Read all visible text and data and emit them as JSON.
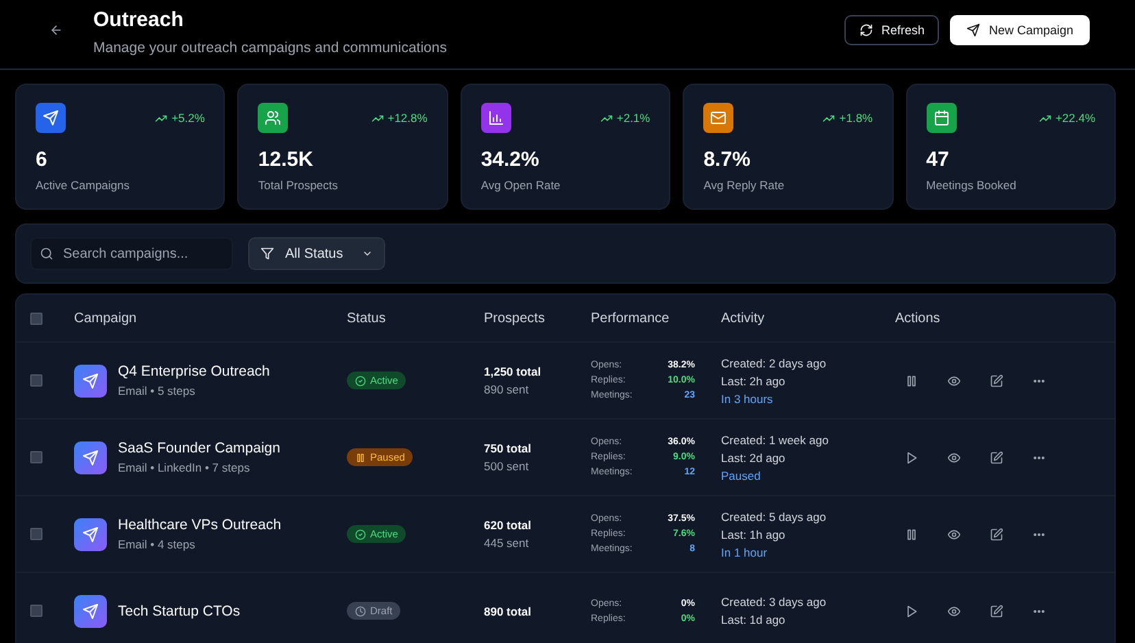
{
  "header": {
    "title": "Outreach",
    "subtitle": "Manage your outreach campaigns and communications"
  },
  "buttons": [
    {
      "kind": "refresh",
      "label": "Refresh"
    },
    {
      "kind": "new",
      "label": "New Campaign"
    }
  ],
  "stats": [
    {
      "color": "#2563eb",
      "change": "+5.2%",
      "value": "6",
      "label": "Active Campaigns"
    },
    {
      "color": "#16a34a",
      "change": "+12.8%",
      "value": "12.5K",
      "label": "Total Prospects"
    },
    {
      "color": "#9333ea",
      "change": "+2.1%",
      "value": "34.2%",
      "label": "Avg Open Rate"
    },
    {
      "color": "#d97706",
      "change": "+1.8%",
      "value": "8.7%",
      "label": "Avg Reply Rate"
    },
    {
      "color": "#16a34a",
      "change": "+22.4%",
      "value": "47",
      "label": "Meetings Booked"
    }
  ],
  "filters": {
    "search": {
      "placeholder": "Search campaigns..."
    },
    "status_filter": {
      "value": "All Status"
    }
  },
  "table": {
    "select_all": {
      "checked": false
    },
    "columns": [
      "Campaign",
      "Status",
      "Prospects",
      "Performance",
      "Activity",
      "Actions"
    ],
    "rows": [
      {
        "checked": false,
        "name": "Q4 Enterprise Outreach",
        "channels": "Email • 5 steps",
        "status": {
          "kind": "active",
          "label": "Active"
        },
        "total": "1,250 total",
        "sent": "890 sent",
        "performance": [
          {
            "kind": "opens",
            "label": "Opens:",
            "value": "38.2%"
          },
          {
            "kind": "replies",
            "label": "Replies:",
            "value": "10.0%"
          },
          {
            "kind": "meetings",
            "label": "Meetings:",
            "value": "23"
          }
        ],
        "created": "Created: 2 days ago",
        "last": "Last: 2h ago",
        "next": "In 3 hours"
      },
      {
        "checked": false,
        "name": "SaaS Founder Campaign",
        "channels": "Email • LinkedIn • 7 steps",
        "status": {
          "kind": "paused",
          "label": "Paused"
        },
        "total": "750 total",
        "sent": "500 sent",
        "performance": [
          {
            "kind": "opens",
            "label": "Opens:",
            "value": "36.0%"
          },
          {
            "kind": "replies",
            "label": "Replies:",
            "value": "9.0%"
          },
          {
            "kind": "meetings",
            "label": "Meetings:",
            "value": "12"
          }
        ],
        "created": "Created: 1 week ago",
        "last": "Last: 2d ago",
        "next": "Paused"
      },
      {
        "checked": false,
        "name": "Healthcare VPs Outreach",
        "channels": "Email • 4 steps",
        "status": {
          "kind": "active",
          "label": "Active"
        },
        "total": "620 total",
        "sent": "445 sent",
        "performance": [
          {
            "kind": "opens",
            "label": "Opens:",
            "value": "37.5%"
          },
          {
            "kind": "replies",
            "label": "Replies:",
            "value": "7.6%"
          },
          {
            "kind": "meetings",
            "label": "Meetings:",
            "value": "8"
          }
        ],
        "created": "Created: 5 days ago",
        "last": "Last: 1h ago",
        "next": "In 1 hour"
      },
      {
        "checked": false,
        "name": "Tech Startup CTOs",
        "status": {
          "kind": "draft",
          "label": "Draft"
        },
        "total": "890 total",
        "performance": [
          {
            "kind": "opens",
            "label": "Opens:",
            "value": "0%"
          },
          {
            "kind": "replies",
            "label": "Replies:",
            "value": "0%"
          }
        ],
        "created": "Created: 3 days ago",
        "last": "Last: 1d ago"
      }
    ]
  }
}
